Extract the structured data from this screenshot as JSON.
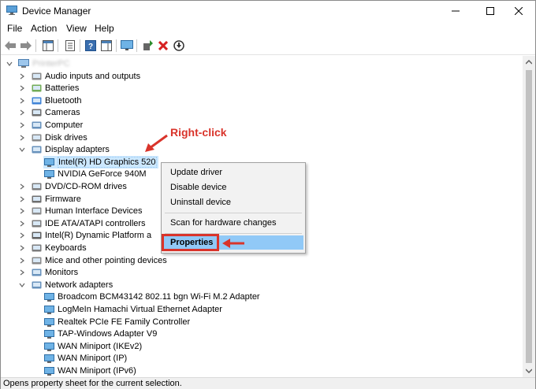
{
  "window": {
    "title": "Device Manager"
  },
  "menu": [
    "File",
    "Action",
    "View",
    "Help"
  ],
  "tree": {
    "root_label": "PrinterPC",
    "items": [
      {
        "label": "Audio inputs and outputs",
        "icon": "speaker-icon",
        "expanded": false
      },
      {
        "label": "Batteries",
        "icon": "battery-icon",
        "expanded": false
      },
      {
        "label": "Bluetooth",
        "icon": "bluetooth-icon",
        "expanded": false
      },
      {
        "label": "Cameras",
        "icon": "camera-icon",
        "expanded": false
      },
      {
        "label": "Computer",
        "icon": "computer-icon",
        "expanded": false
      },
      {
        "label": "Disk drives",
        "icon": "disk-icon",
        "expanded": false
      },
      {
        "label": "Display adapters",
        "icon": "display-icon",
        "expanded": true,
        "children": [
          {
            "label": "Intel(R) HD Graphics 520",
            "selected": true
          },
          {
            "label": "NVIDIA GeForce 940M"
          }
        ]
      },
      {
        "label": "DVD/CD-ROM drives",
        "icon": "dvd-icon",
        "expanded": false
      },
      {
        "label": "Firmware",
        "icon": "firmware-icon",
        "expanded": false
      },
      {
        "label": "Human Interface Devices",
        "icon": "hid-icon",
        "expanded": false
      },
      {
        "label": "IDE ATA/ATAPI controllers",
        "icon": "ide-icon",
        "expanded": false
      },
      {
        "label": "Intel(R) Dynamic Platform a",
        "icon": "chip-icon",
        "expanded": false
      },
      {
        "label": "Keyboards",
        "icon": "keyboard-icon",
        "expanded": false
      },
      {
        "label": "Mice and other pointing devices",
        "icon": "mouse-icon",
        "expanded": false
      },
      {
        "label": "Monitors",
        "icon": "monitor-icon",
        "expanded": false
      },
      {
        "label": "Network adapters",
        "icon": "network-icon",
        "expanded": true,
        "children": [
          {
            "label": "Broadcom BCM43142 802.11 bgn Wi-Fi M.2 Adapter"
          },
          {
            "label": "LogMeIn Hamachi Virtual Ethernet Adapter"
          },
          {
            "label": "Realtek PCIe FE Family Controller"
          },
          {
            "label": "TAP-Windows Adapter V9"
          },
          {
            "label": "WAN Miniport (IKEv2)"
          },
          {
            "label": "WAN Miniport (IP)"
          },
          {
            "label": "WAN Miniport (IPv6)"
          }
        ]
      }
    ]
  },
  "context_menu": {
    "update_driver": "Update driver",
    "disable_device": "Disable device",
    "uninstall_device": "Uninstall device",
    "scan": "Scan for hardware changes",
    "properties": "Properties"
  },
  "annotation": {
    "text": "Right-click",
    "color": "#d9342b"
  },
  "status": "Opens property sheet for the current selection.",
  "colors": {
    "selection": "#cce8ff",
    "highlight": "#91c9f7",
    "annotation": "#d9342b"
  }
}
